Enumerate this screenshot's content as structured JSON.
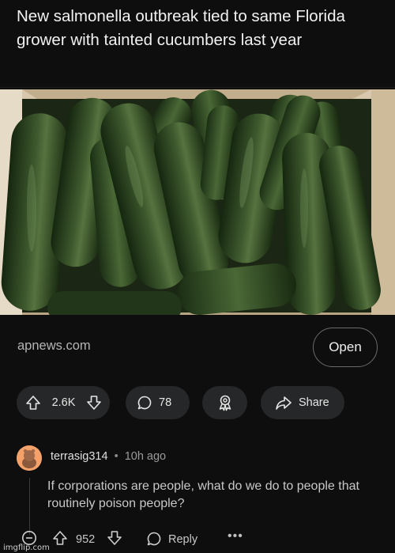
{
  "post": {
    "title": "New salmonella outbreak tied to same Florida grower with tainted cucumbers last year"
  },
  "link": {
    "domain": "apnews.com",
    "open_label": "Open"
  },
  "actions": {
    "vote_count": "2.6K",
    "comment_count": "78",
    "share_label": "Share"
  },
  "comment": {
    "username": "terrasig314",
    "separator": "•",
    "time": "10h ago",
    "body": "If corporations are people, what do we do to people that routinely poison people?",
    "score": "952",
    "reply_label": "Reply",
    "more_label": "•••"
  },
  "watermark": "imgflip.com",
  "colors": {
    "background": "#0e0e0f",
    "pill": "#262728",
    "avatar": "#f4a16a"
  },
  "icons": [
    "upvote-icon",
    "downvote-icon",
    "comment-bubble-icon",
    "award-icon",
    "share-arrow-icon",
    "collapse-icon",
    "reply-bubble-icon"
  ]
}
